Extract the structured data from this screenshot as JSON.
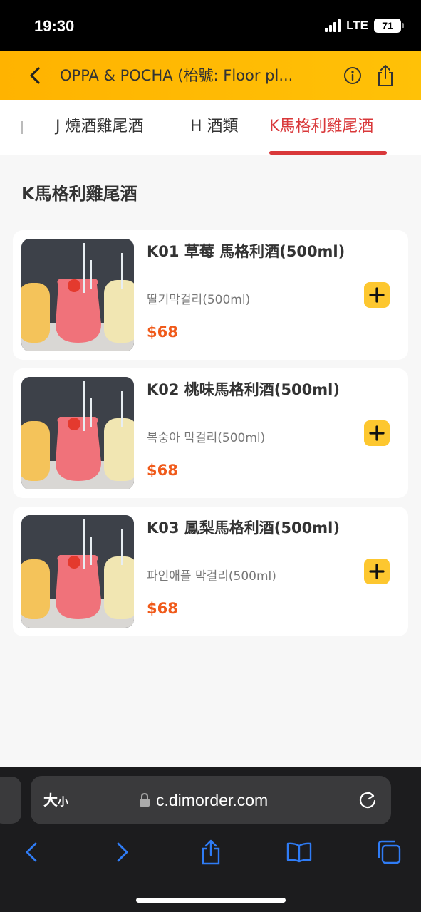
{
  "status": {
    "time": "19:30",
    "network": "LTE",
    "battery": "71"
  },
  "header": {
    "title": "OPPA & POCHA (枱號: Floor pl..."
  },
  "tabs": [
    {
      "label": "J 燒酒雞尾酒"
    },
    {
      "label": "H 酒類"
    },
    {
      "label": "K馬格利雞尾酒",
      "active": true
    }
  ],
  "section": {
    "title": "K馬格利雞尾酒"
  },
  "products": [
    {
      "name": "K01 草莓 馬格利酒(500ml)",
      "subtitle": "딸기막걸리(500ml)",
      "price": "$68"
    },
    {
      "name": "K02 桃味馬格利酒(500ml)",
      "subtitle": "복숭아 막걸리(500ml)",
      "price": "$68"
    },
    {
      "name": "K03 鳳梨馬格利酒(500ml)",
      "subtitle": "파인애플 막걸리(500ml)",
      "price": "$68"
    }
  ],
  "browser": {
    "text_size_label": "大",
    "text_size_small": "小",
    "url": "c.dimorder.com"
  },
  "colors": {
    "header": "#ffb300",
    "accent": "#d9383a",
    "price": "#f05a1a",
    "add_button": "#fdc72f"
  },
  "icons": [
    "back-icon",
    "info-icon",
    "share-icon",
    "plus-icon",
    "lock-icon",
    "reload-icon",
    "safari-back-icon",
    "safari-forward-icon",
    "safari-share-icon",
    "bookmarks-icon",
    "tabs-icon"
  ]
}
